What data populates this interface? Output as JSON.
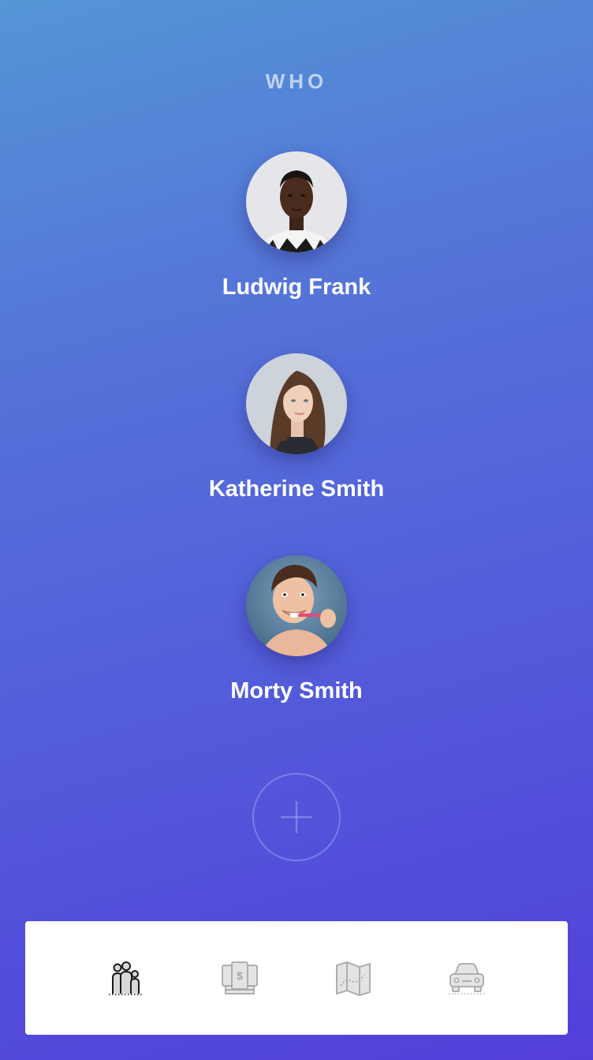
{
  "header": {
    "title": "WHO"
  },
  "people": [
    {
      "name": "Ludwig Frank"
    },
    {
      "name": "Katherine Smith"
    },
    {
      "name": "Morty Smith"
    }
  ],
  "add_button": {
    "icon": "plus-icon"
  },
  "tab_bar": {
    "tabs": [
      {
        "icon": "family-icon",
        "active": true
      },
      {
        "icon": "money-icon",
        "active": false
      },
      {
        "icon": "map-icon",
        "active": false
      },
      {
        "icon": "car-icon",
        "active": false
      }
    ]
  },
  "colors": {
    "gradient_top": "#5496d6",
    "gradient_bottom": "#523fd9",
    "title_text": "#cddaf5",
    "name_text": "#ffffff",
    "tab_active": "#1a1a1a",
    "tab_inactive": "#a8a8a8"
  }
}
